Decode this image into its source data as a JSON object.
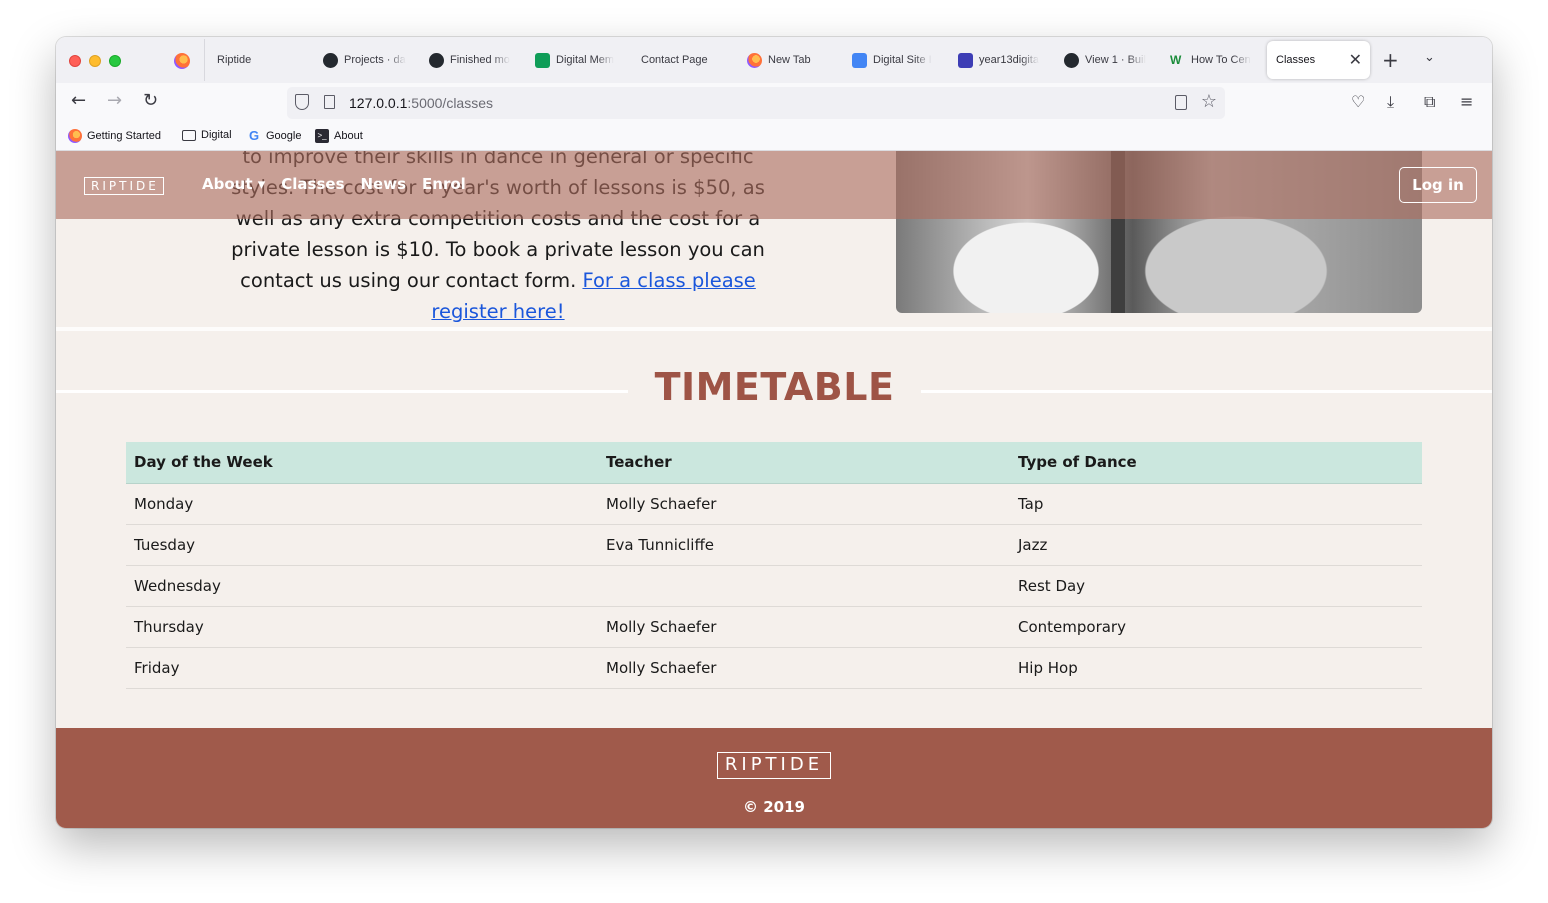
{
  "browser": {
    "tabs": [
      {
        "label": "Riptide"
      },
      {
        "label": "Projects · da"
      },
      {
        "label": "Finished mo"
      },
      {
        "label": "Digital Mem"
      },
      {
        "label": "Contact Page"
      },
      {
        "label": "New Tab"
      },
      {
        "label": "Digital Site I"
      },
      {
        "label": "year13digita"
      },
      {
        "label": "View 1 · Buil"
      },
      {
        "label": "How To Cen"
      }
    ],
    "active_tab": {
      "label": "Classes",
      "close": "✕"
    },
    "new_tab": "+",
    "tab_list": "⌄",
    "url_host": "127.0.0.1",
    "url_path": ":5000/classes",
    "bookmarks": [
      {
        "label": "Getting Started"
      },
      {
        "label": "Digital"
      },
      {
        "label": "Google"
      },
      {
        "label": "About"
      }
    ]
  },
  "site": {
    "brand": "RIPTIDE",
    "nav": {
      "about": "About ▾",
      "classes": "Classes",
      "news": "News",
      "enrol": "Enrol"
    },
    "login": "Log in",
    "intro": {
      "text": "to improve their skills in dance in general or specific styles. The cost for a year's worth of lessons is $50, as well as any extra competition costs and the cost for a private lesson is $10. To book a private lesson you can contact us using our contact form. ",
      "link": "For a class please register here!"
    },
    "timetable": {
      "title": "TIMETABLE",
      "headers": [
        "Day of the Week",
        "Teacher",
        "Type of Dance"
      ],
      "rows": [
        [
          "Monday",
          "Molly Schaefer",
          "Tap"
        ],
        [
          "Tuesday",
          "Eva Tunnicliffe",
          "Jazz"
        ],
        [
          "Wednesday",
          "",
          "Rest Day"
        ],
        [
          "Thursday",
          "Molly Schaefer",
          "Contemporary"
        ],
        [
          "Friday",
          "Molly Schaefer",
          "Hip Hop"
        ]
      ]
    },
    "footer": {
      "brand": "RIPTIDE",
      "copyright": "© 2019"
    }
  }
}
